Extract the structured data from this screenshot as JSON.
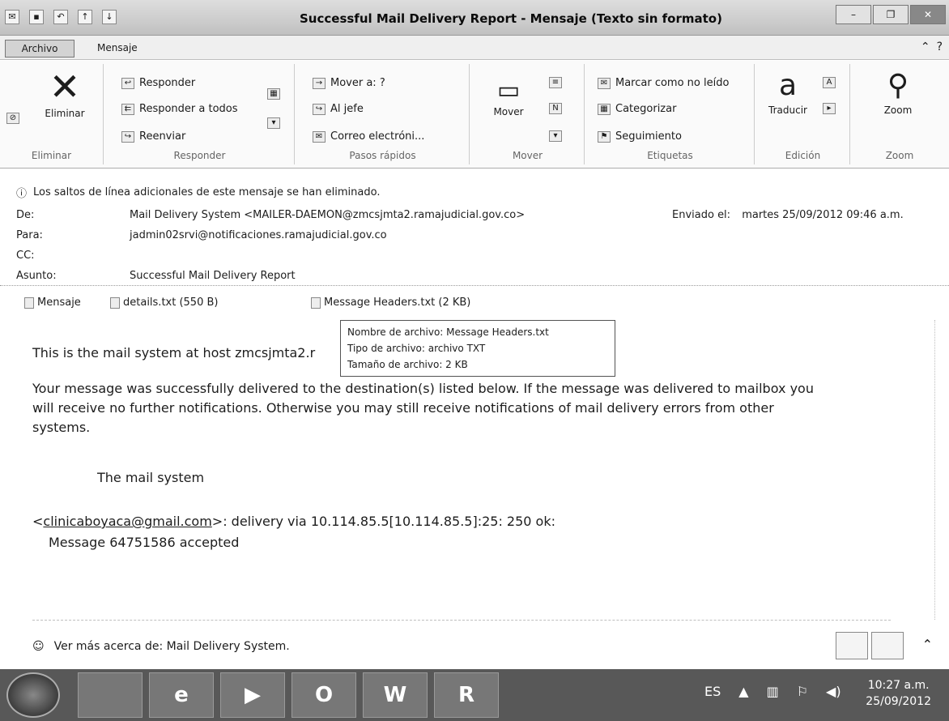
{
  "window": {
    "title": "Successful Mail Delivery Report - Mensaje (Texto sin formato)",
    "controls": [
      "–",
      "❐",
      "✕"
    ]
  },
  "tabs": {
    "file": "Archivo",
    "message": "Mensaje"
  },
  "ribbon": {
    "delete_group": {
      "label": "Eliminar",
      "delete": "Eliminar"
    },
    "respond_group": {
      "label": "Responder",
      "reply": "Responder",
      "reply_all": "Responder a todos",
      "forward": "Reenviar"
    },
    "quick_group": {
      "label": "Pasos rápidos",
      "move_to": "Mover a: ?",
      "to_boss": "Al jefe",
      "email": "Correo electróni..."
    },
    "move_group": {
      "label": "Mover",
      "move": "Mover"
    },
    "tags_group": {
      "label": "Etiquetas",
      "mark_unread": "Marcar como no leído",
      "categorize": "Categorizar",
      "followup": "Seguimiento"
    },
    "edit_group": {
      "label": "Edición",
      "translate": "Traducir"
    },
    "zoom_group": {
      "label": "Zoom",
      "zoom": "Zoom"
    }
  },
  "info_bar": "Los saltos de línea adicionales de este mensaje se han eliminado.",
  "header": {
    "from_label": "De:",
    "from": "Mail Delivery System <MAILER-DAEMON@zmcsjmta2.ramajudicial.gov.co>",
    "to_label": "Para:",
    "to": "jadmin02srvi@notificaciones.ramajudicial.gov.co",
    "cc_label": "CC:",
    "cc": "",
    "subject_label": "Asunto:",
    "subject": "Successful Mail Delivery Report",
    "sent_label": "Enviado el:",
    "sent": "martes 25/09/2012 09:46 a.m."
  },
  "attachments": [
    {
      "name": "Mensaje"
    },
    {
      "name": "details.txt (550 B)"
    },
    {
      "name": "Message Headers.txt (2 KB)"
    }
  ],
  "tooltip": {
    "filename": "Nombre de archivo: Message Headers.txt",
    "type": "Tipo de archivo: archivo TXT",
    "size": "Tamaño de archivo: 2 KB"
  },
  "body": {
    "line1": "This is the mail system at host zmcsjmta2.r",
    "para2a": "Your message was successfully delivered to the destination(s) listed below. If the message was delivered to mailbox you",
    "para2b": "will receive no further notifications. Otherwise you may still receive notifications of mail delivery errors from other",
    "para2c": "systems.",
    "signature": "The mail system",
    "recipient_prefix": "<",
    "recipient_link": "clinicaboyaca@gmail.com",
    "recipient_suffix": ">: delivery via 10.114.85.5[10.114.85.5]:25: 250 ok:",
    "accepted": "Message 64751586 accepted"
  },
  "people_pane": {
    "text": "Ver más acerca de: Mail Delivery System."
  },
  "taskbar": {
    "lang": "ES",
    "time": "10:27 a.m.",
    "date": "25/09/2012",
    "apps": [
      "",
      "e",
      "▶",
      "O",
      "W",
      "R"
    ]
  }
}
